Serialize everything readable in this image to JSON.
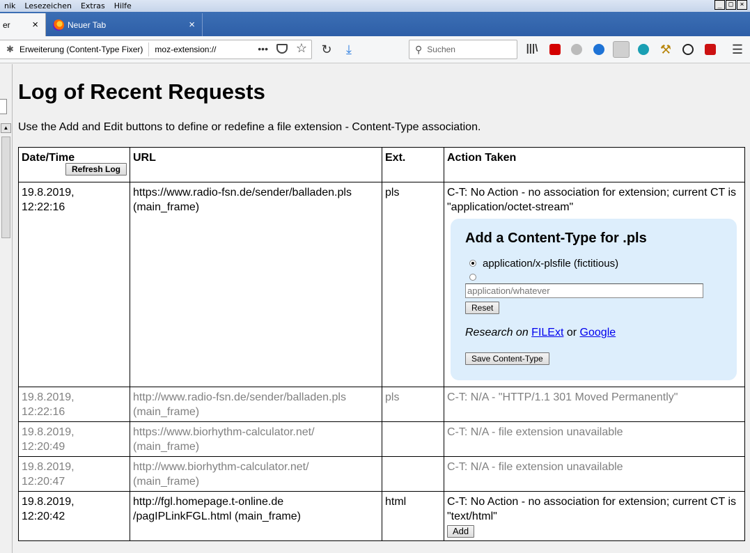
{
  "menubar": {
    "items": [
      "nik",
      "Lesezeichen",
      "Extras",
      "Hilfe"
    ],
    "window_buttons": [
      "_",
      "□",
      "×"
    ]
  },
  "tabs": [
    {
      "label": "er",
      "close": "×"
    },
    {
      "label": "Neuer Tab",
      "close": "×"
    }
  ],
  "navbar": {
    "identity": "Erweiterung (Content-Type Fixer)",
    "url": "moz-extension://",
    "dots": "•••",
    "search_placeholder": "Suchen"
  },
  "page": {
    "title": "Log of Recent Requests",
    "intro": "Use the Add and Edit buttons to define or redefine a file extension - Content-Type association.",
    "headers": {
      "datetime": "Date/Time",
      "url": "URL",
      "ext": "Ext.",
      "action": "Action Taken"
    },
    "refresh_label": "Refresh Log",
    "rows": [
      {
        "date": "19.8.2019,",
        "time": "12:22:16",
        "url": "https://www.radio-fsn.de/sender/balladen.pls",
        "frame": "(main_frame)",
        "ext": "pls",
        "action": "C-T: No Action - no association for extension; current CT is \"application/octet-stream\""
      },
      {
        "date": "19.8.2019,",
        "time": "12:22:16",
        "url": "http://www.radio-fsn.de/sender/balladen.pls",
        "frame": "(main_frame)",
        "ext": "pls",
        "action": "C-T: N/A - \"HTTP/1.1 301 Moved Permanently\""
      },
      {
        "date": "19.8.2019,",
        "time": "12:20:49",
        "url": "https://www.biorhythm-calculator.net/",
        "frame": "(main_frame)",
        "ext": "",
        "action": "C-T: N/A - file extension unavailable"
      },
      {
        "date": "19.8.2019,",
        "time": "12:20:47",
        "url": "http://www.biorhythm-calculator.net/",
        "frame": "(main_frame)",
        "ext": "",
        "action": "C-T: N/A - file extension unavailable"
      },
      {
        "date": "19.8.2019,",
        "time": "12:20:42",
        "url": "http://fgl.homepage.t-online.de",
        "frame": "/pagIPLinkFGL.html (main_frame)",
        "ext": "html",
        "action": "C-T: No Action - no association for extension; current CT is \"text/html\"",
        "add_label": "Add"
      }
    ],
    "addbox": {
      "title": "Add a Content-Type for .pls",
      "option1": "application/x-plsfile (fictitious)",
      "input_placeholder": "application/whatever",
      "reset_label": "Reset",
      "research_prefix": "Research on",
      "link1": "FILExt",
      "or": "or",
      "link2": "Google",
      "save_label": "Save Content-Type"
    }
  }
}
